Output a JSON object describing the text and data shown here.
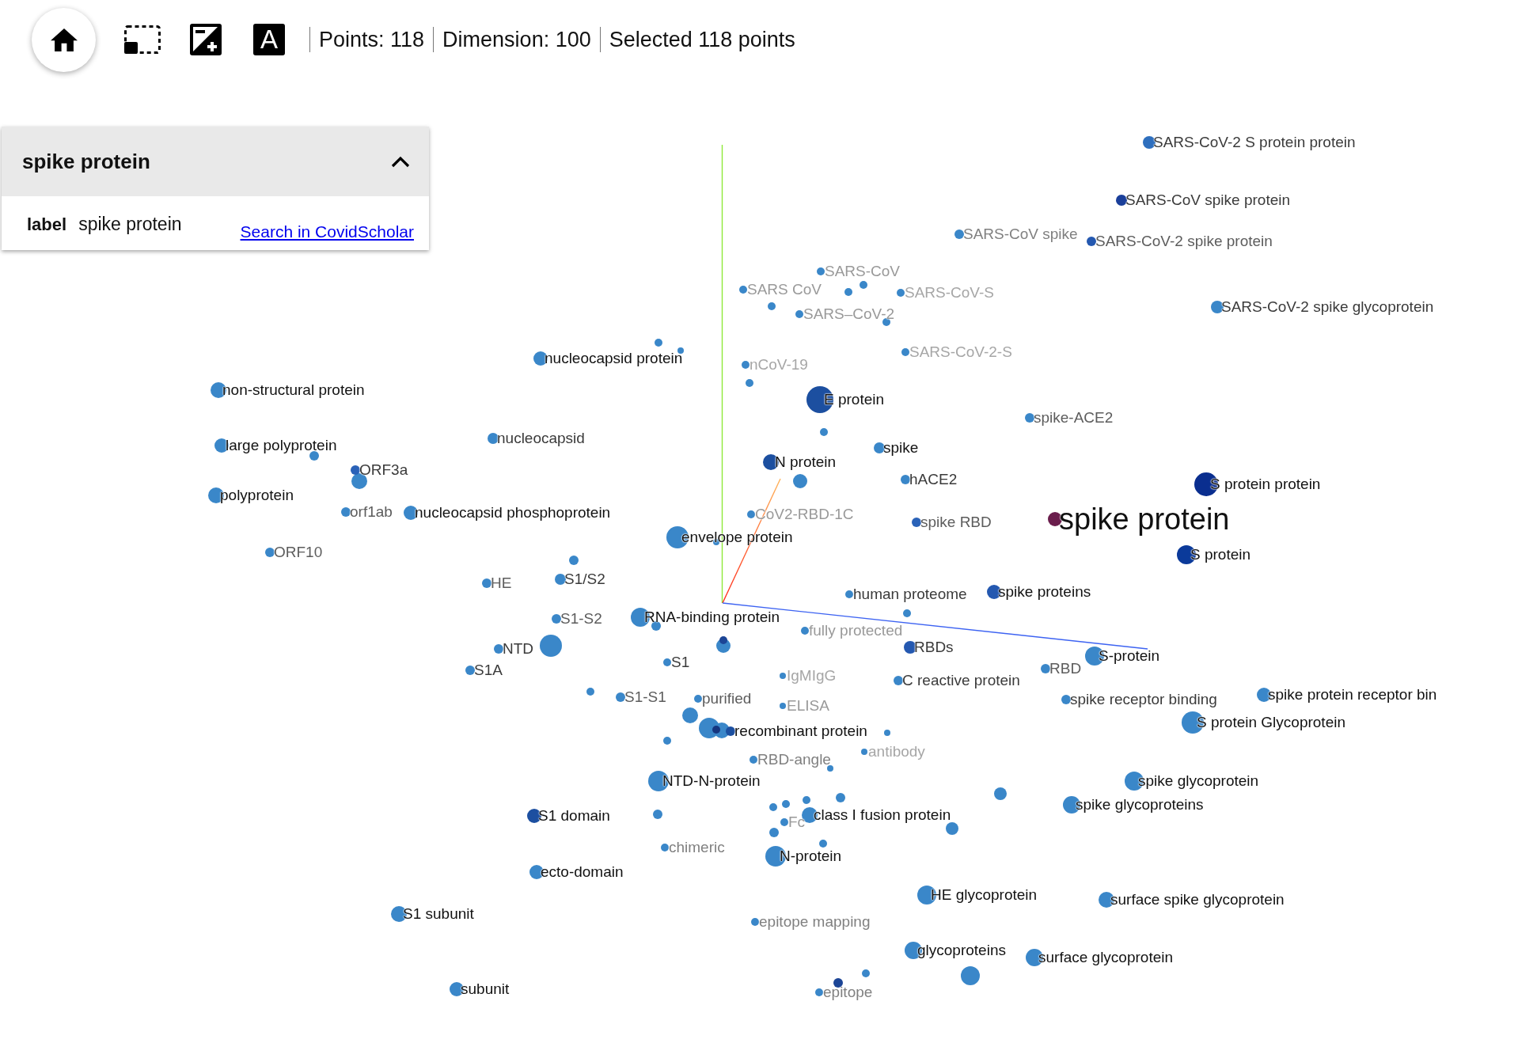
{
  "toolbar": {
    "tools": [
      {
        "kind": "home"
      },
      {
        "kind": "select"
      },
      {
        "kind": "contrast"
      },
      {
        "kind": "labels",
        "glyph": "A"
      }
    ],
    "stats": [
      "Points: 118",
      "Dimension: 100",
      "Selected 118 points"
    ]
  },
  "inspector": {
    "title": "spike protein",
    "expanded": true,
    "fields": [
      {
        "key": "label",
        "value": "spike protein"
      }
    ],
    "link": "Search in CovidScholar"
  },
  "projection": {
    "points": [
      {
        "label": "SARS-CoV-2 S protein protein",
        "color": "#2e6fbe",
        "selected": false
      },
      {
        "label": "SARS-CoV spike protein",
        "color": "#1a3f9a",
        "selected": false
      },
      {
        "label": "SARS-CoV spike",
        "color": "#3a87c9",
        "selected": false
      },
      {
        "label": "SARS-CoV-2 spike protein",
        "color": "#2458b0",
        "selected": false
      },
      {
        "label": "SARS-CoV",
        "color": "#3a87c9",
        "selected": false
      },
      {
        "label": "SARS CoV",
        "color": "#3a87c9",
        "selected": false
      },
      {
        "label": "SARS-CoV-S",
        "color": "#3a87c9",
        "selected": false
      },
      {
        "label": "SARS–CoV-2",
        "color": "#3a87c9",
        "selected": false
      },
      {
        "label": "SARS-CoV-2 spike glycoprotein",
        "color": "#3a87c9",
        "selected": false
      },
      {
        "label": "nucleocapsid protein",
        "color": "#3a87c9",
        "selected": false
      },
      {
        "label": "nCoV-19",
        "color": "#3a87c9",
        "selected": false
      },
      {
        "label": "SARS-CoV-2-S",
        "color": "#3a87c9",
        "selected": false
      },
      {
        "label": "non-structural protein",
        "color": "#3a87c9",
        "selected": false
      },
      {
        "label": "E protein",
        "color": "#1c4fa0",
        "selected": false
      },
      {
        "label": "spike-ACE2",
        "color": "#3a87c9",
        "selected": false
      },
      {
        "label": "nucleocapsid",
        "color": "#3a87c9",
        "selected": false
      },
      {
        "label": "large polyprotein",
        "color": "#3a87c9",
        "selected": false
      },
      {
        "label": "spike",
        "color": "#3a87c9",
        "selected": false
      },
      {
        "label": "ORF3a",
        "color": "#2a62b8",
        "selected": false
      },
      {
        "label": "N protein",
        "color": "#1c4fa0",
        "selected": false
      },
      {
        "label": "hACE2",
        "color": "#3a87c9",
        "selected": false
      },
      {
        "label": "S protein protein",
        "color": "#0a2e8f",
        "selected": false
      },
      {
        "label": "polyprotein",
        "color": "#3a87c9",
        "selected": false
      },
      {
        "label": "orf1ab",
        "color": "#3a87c9",
        "selected": false
      },
      {
        "label": "nucleocapsid phosphoprotein",
        "color": "#3a87c9",
        "selected": false
      },
      {
        "label": "CoV2-RBD-1C",
        "color": "#3a87c9",
        "selected": false
      },
      {
        "label": "spike RBD",
        "color": "#2a62b8",
        "selected": false
      },
      {
        "label": "spike protein",
        "color": "#6a1d4c",
        "selected": true
      },
      {
        "label": "envelope protein",
        "color": "#3a87c9",
        "selected": false
      },
      {
        "label": "ORF10",
        "color": "#3a87c9",
        "selected": false
      },
      {
        "label": "S protein",
        "color": "#0b3a9a",
        "selected": false
      },
      {
        "label": "HE",
        "color": "#3a87c9",
        "selected": false
      },
      {
        "label": "S1/S2",
        "color": "#3a87c9",
        "selected": false
      },
      {
        "label": "human proteome",
        "color": "#3a87c9",
        "selected": false
      },
      {
        "label": "spike proteins",
        "color": "#2458b0",
        "selected": false
      },
      {
        "label": "S1-S2",
        "color": "#3a87c9",
        "selected": false
      },
      {
        "label": "RNA-binding protein",
        "color": "#3a87c9",
        "selected": false
      },
      {
        "label": "fully protected",
        "color": "#3a87c9",
        "selected": false
      },
      {
        "label": "NTD",
        "color": "#3a87c9",
        "selected": false
      },
      {
        "label": "S1",
        "color": "#3a87c9",
        "selected": false
      },
      {
        "label": "RBDs",
        "color": "#2458b0",
        "selected": false
      },
      {
        "label": "S-protein",
        "color": "#3a87c9",
        "selected": false
      },
      {
        "label": "S1A",
        "color": "#3a87c9",
        "selected": false
      },
      {
        "label": "IgMIgG",
        "color": "#3a87c9",
        "selected": false
      },
      {
        "label": "C reactive protein",
        "color": "#3a87c9",
        "selected": false
      },
      {
        "label": "RBD",
        "color": "#3a87c9",
        "selected": false
      },
      {
        "label": "S1-S1",
        "color": "#3a87c9",
        "selected": false
      },
      {
        "label": "purified",
        "color": "#3a87c9",
        "selected": false
      },
      {
        "label": "ELISA",
        "color": "#3a87c9",
        "selected": false
      },
      {
        "label": "spike receptor binding",
        "color": "#3a87c9",
        "selected": false
      },
      {
        "label": "spike protein receptor bin",
        "color": "#3a87c9",
        "selected": false
      },
      {
        "label": "recombinant protein",
        "color": "#1c4fa0",
        "selected": false
      },
      {
        "label": "S protein Glycoprotein",
        "color": "#3a87c9",
        "selected": false
      },
      {
        "label": "RBD-angle",
        "color": "#3a87c9",
        "selected": false
      },
      {
        "label": "antibody",
        "color": "#3a87c9",
        "selected": false
      },
      {
        "label": "NTD-N-protein",
        "color": "#3a87c9",
        "selected": false
      },
      {
        "label": "spike glycoprotein",
        "color": "#3a87c9",
        "selected": false
      },
      {
        "label": "S1 domain",
        "color": "#1c4fa0",
        "selected": false
      },
      {
        "label": "Fc",
        "color": "#3a87c9",
        "selected": false
      },
      {
        "label": "class I fusion protein",
        "color": "#3a87c9",
        "selected": false
      },
      {
        "label": "spike glycoproteins",
        "color": "#3a87c9",
        "selected": false
      },
      {
        "label": "chimeric",
        "color": "#3a87c9",
        "selected": false
      },
      {
        "label": "N-protein",
        "color": "#3a87c9",
        "selected": false
      },
      {
        "label": "ecto-domain",
        "color": "#3a87c9",
        "selected": false
      },
      {
        "label": "HE glycoprotein",
        "color": "#3a87c9",
        "selected": false
      },
      {
        "label": "surface spike glycoprotein",
        "color": "#3a87c9",
        "selected": false
      },
      {
        "label": "S1 subunit",
        "color": "#3a87c9",
        "selected": false
      },
      {
        "label": "epitope mapping",
        "color": "#3a87c9",
        "selected": false
      },
      {
        "label": "glycoproteins",
        "color": "#3a87c9",
        "selected": false
      },
      {
        "label": "surface glycoprotein",
        "color": "#3a87c9",
        "selected": false
      },
      {
        "label": "subunit",
        "color": "#3a87c9",
        "selected": false
      },
      {
        "label": "epitope",
        "color": "#3a87c9",
        "selected": false
      },
      {
        "color": "#3a87c9",
        "selected": false
      },
      {
        "color": "#3a87c9",
        "selected": false
      },
      {
        "color": "#3a87c9",
        "selected": false
      },
      {
        "color": "#3a87c9",
        "selected": false
      },
      {
        "color": "#3a87c9",
        "selected": false
      },
      {
        "color": "#3a87c9",
        "selected": false
      },
      {
        "color": "#3a87c9",
        "selected": false
      },
      {
        "color": "#3a87c9",
        "selected": false
      },
      {
        "color": "#3a87c9",
        "selected": false
      },
      {
        "color": "#3a87c9",
        "selected": false
      },
      {
        "color": "#3a87c9",
        "selected": false
      },
      {
        "color": "#3a87c9",
        "selected": false
      },
      {
        "color": "#3a87c9",
        "selected": false
      },
      {
        "color": "#3a87c9",
        "selected": false
      },
      {
        "color": "#3a87c9",
        "selected": false
      },
      {
        "color": "#3a87c9",
        "selected": false
      },
      {
        "color": "#1c4596",
        "selected": false
      },
      {
        "color": "#3a87c9",
        "selected": false
      },
      {
        "color": "#3a87c9",
        "selected": false
      },
      {
        "color": "#3a87c9",
        "selected": false
      },
      {
        "color": "#3a87c9",
        "selected": false
      },
      {
        "color": "#3a87c9",
        "selected": false
      },
      {
        "color": "#3a87c9",
        "selected": false
      },
      {
        "color": "#3a87c9",
        "selected": false
      },
      {
        "color": "#3a87c9",
        "selected": false
      },
      {
        "color": "#3a87c9",
        "selected": false
      },
      {
        "color": "#3a87c9",
        "selected": false
      },
      {
        "color": "#3a87c9",
        "selected": false
      },
      {
        "color": "#3a87c9",
        "selected": false
      },
      {
        "color": "#3a87c9",
        "selected": false
      },
      {
        "color": "#3a87c9",
        "selected": false
      },
      {
        "color": "#3a87c9",
        "selected": false
      },
      {
        "color": "#3a87c9",
        "selected": false
      },
      {
        "color": "#3a87c9",
        "selected": false
      },
      {
        "color": "#3a87c9",
        "selected": false
      },
      {
        "color": "#1c4596",
        "selected": false
      },
      {
        "color": "#3a87c9",
        "selected": false
      },
      {
        "color": "#15357f",
        "selected": false
      }
    ]
  }
}
